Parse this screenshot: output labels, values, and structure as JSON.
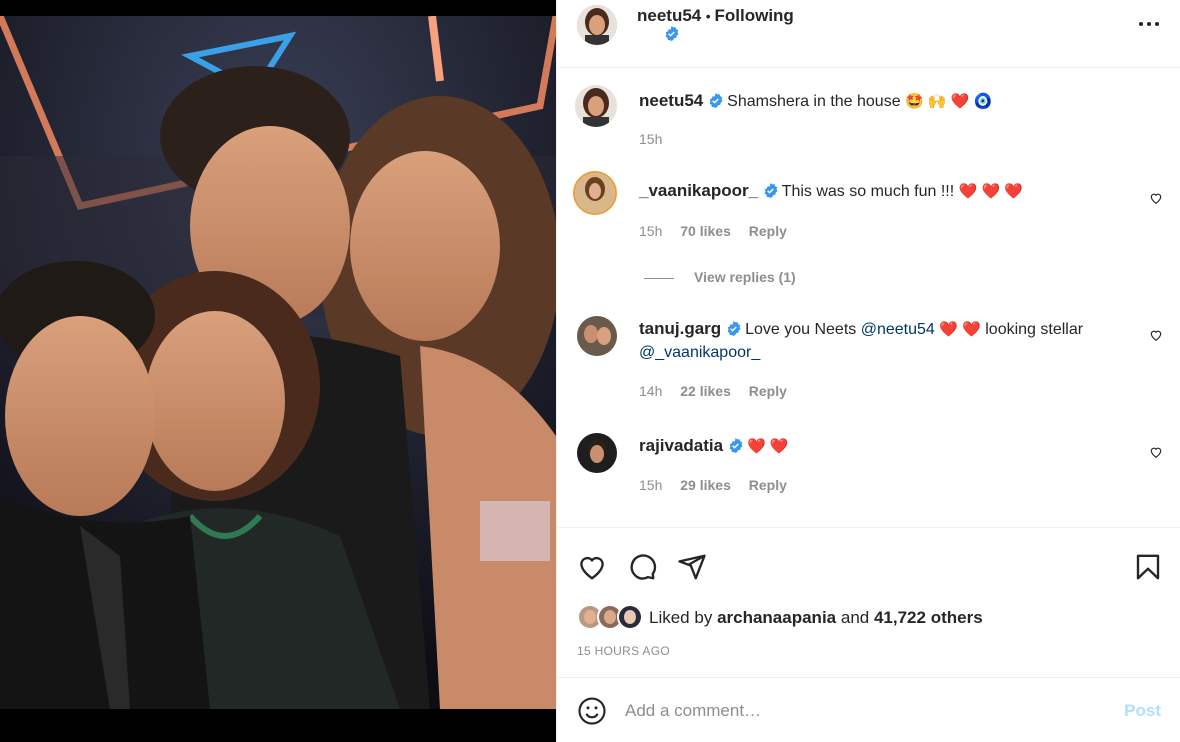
{
  "header": {
    "username": "neetu54",
    "follow_status": "Following"
  },
  "caption": {
    "username": "neetu54",
    "text": "Shamshera in the house",
    "emojis": "🤩 🙌 ❤️ 🧿",
    "time": "15h"
  },
  "comments": [
    {
      "username": "_vaanikapoor_",
      "text": "This was so much fun !!!",
      "emojis": "❤️ ❤️ ❤️",
      "time": "15h",
      "likes": "70 likes",
      "reply": "Reply",
      "view_replies": "View replies (1)"
    },
    {
      "username": "tanuj.garg",
      "text_before": "Love you Neets",
      "mention1": "@neetu54",
      "emojis": "❤️ ❤️",
      "text_after": "looking stellar",
      "mention2": "@_vaanikapoor_",
      "time": "14h",
      "likes": "22 likes",
      "reply": "Reply"
    },
    {
      "username": "rajivadatia",
      "emojis": "❤️ ❤️",
      "time": "15h",
      "likes": "29 likes",
      "reply": "Reply"
    }
  ],
  "likes": {
    "prefix": "Liked by",
    "user": "archanaapania",
    "middle": "and",
    "others": "41,722 others"
  },
  "timestamp": "15 HOURS AGO",
  "add_comment": {
    "placeholder": "Add a comment…",
    "post_label": "Post"
  },
  "colors": {
    "accent": "#0095f6",
    "verified": "#3897f0",
    "heart_red": "#ed4956",
    "post_disabled": "#b2dffc"
  }
}
